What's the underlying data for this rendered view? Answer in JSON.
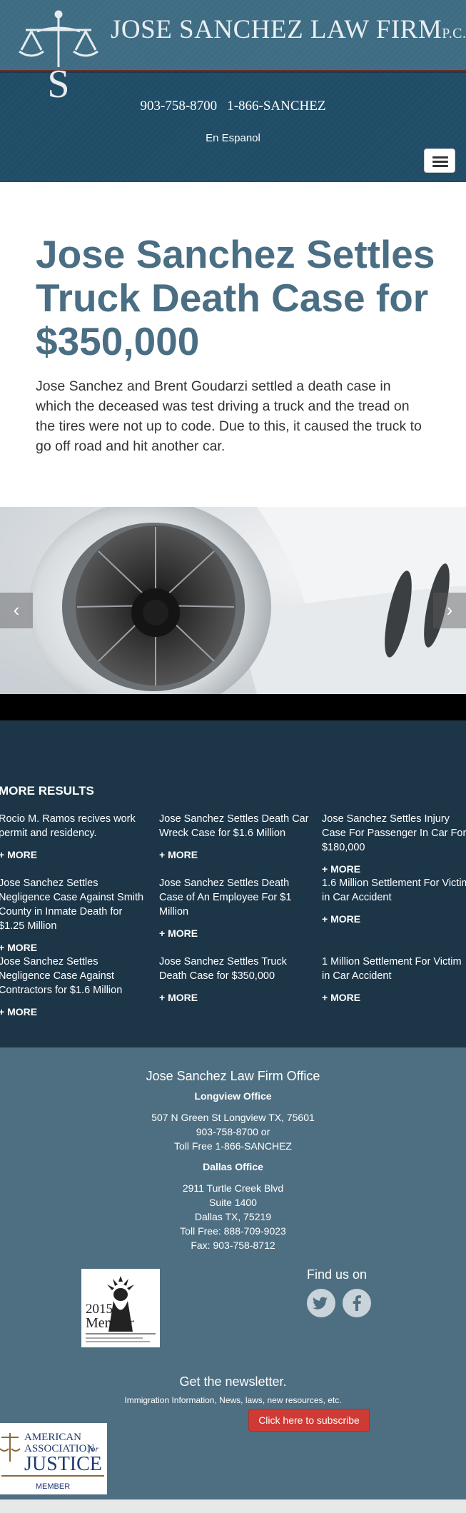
{
  "header": {
    "firm_name": "JOSE SANCHEZ LAW FIRM",
    "firm_suffix": "P.C.",
    "phone_main": "903-758-8700",
    "phone_tollfree": "1-866-SANCHEZ",
    "espanol_link": "En Espanol",
    "logo_letter": "S"
  },
  "article": {
    "title": "Jose Sanchez Settles Truck Death Case for $350,000",
    "body": "Jose Sanchez and Brent Goudarzi settled a death case in which the deceased was test driving a truck and the tread on the tires were not up to code. Due to this, it caused the truck to go off road and hit another car."
  },
  "slider": {
    "prev_icon": "chevron-left-icon",
    "next_icon": "chevron-right-icon",
    "prev_glyph": "‹",
    "next_glyph": "›"
  },
  "results": {
    "heading": "MORE RESULTS",
    "more_label": "+ MORE",
    "items": [
      {
        "title": "Rocio M. Ramos recives work permit and residency."
      },
      {
        "title": "Jose Sanchez Settles Death Car Wreck Case for $1.6 Million"
      },
      {
        "title": "Jose Sanchez Settles Injury Case For Passenger In Car For $180,000"
      },
      {
        "title": "Jose Sanchez Settles Negligence Case Against Smith County in Inmate Death for $1.25 Million"
      },
      {
        "title": "Jose Sanchez Settles Death Case of An Employee For $1 Million"
      },
      {
        "title": "1.6 Million Settlement For Victim in Car Accident"
      },
      {
        "title": "Jose Sanchez Settles Negligence Case Against Contractors for $1.6 Million"
      },
      {
        "title": "Jose Sanchez Settles Truck Death Case for $350,000"
      },
      {
        "title": "1 Million Settlement For Victim in Car Accident"
      }
    ]
  },
  "footer": {
    "office_title": "Jose Sanchez Law Firm Office",
    "longview_title": "Longview Office",
    "longview_address": "507 N Green St Longview TX, 75601",
    "longview_phone": "903-758-8700 or",
    "longview_tollfree": "Toll Free 1-866-SANCHEZ",
    "dallas_title": "Dallas Office",
    "dallas_street": "2911 Turtle Creek Blvd",
    "dallas_suite": "Suite 1400",
    "dallas_city": "Dallas TX, 75219",
    "dallas_tollfree": "Toll Free: 888-709-9023",
    "dallas_fax": "Fax: 903-758-8712",
    "badge_year": "2015",
    "badge_label": "Member",
    "find_us": "Find us on",
    "social": [
      "twitter-icon",
      "facebook-icon"
    ],
    "newsletter_title": "Get the newsletter.",
    "newsletter_sub": "Immigration Information, News, laws, new resources, etc.",
    "subscribe_label": "Click here to subscribe",
    "aaj_line1": "AMERICAN",
    "aaj_line2": "ASSOCIATION",
    "aaj_for": "for",
    "aaj_line3": "JUSTICE",
    "aaj_member": "MEMBER"
  },
  "colors": {
    "header_bg": "#1f4c66",
    "title_color": "#4a6e83",
    "results_bg": "#1c3648",
    "footer_bg": "#4e6f82",
    "subscribe_bg": "#d03a35"
  }
}
